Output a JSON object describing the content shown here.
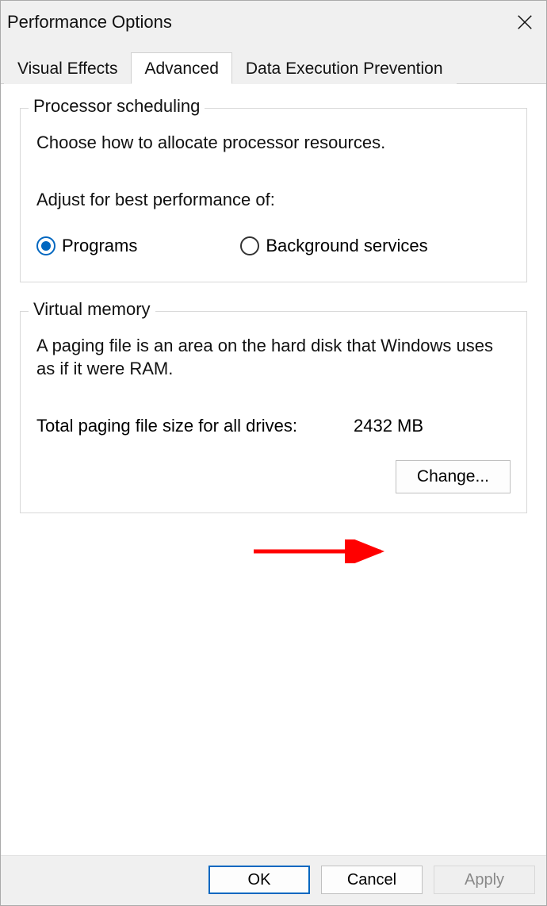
{
  "dialog_title": "Performance Options",
  "tabs": {
    "visual_effects": "Visual Effects",
    "advanced": "Advanced",
    "dep": "Data Execution Prevention"
  },
  "processor_scheduling": {
    "title": "Processor scheduling",
    "description": "Choose how to allocate processor resources.",
    "subtitle": "Adjust for best performance of:",
    "programs_label": "Programs",
    "background_label": "Background services"
  },
  "virtual_memory": {
    "title": "Virtual memory",
    "description": "A paging file is an area on the hard disk that Windows uses as if it were RAM.",
    "total_label": "Total paging file size for all drives:",
    "total_value": "2432 MB",
    "change_label": "Change..."
  },
  "buttons": {
    "ok": "OK",
    "cancel": "Cancel",
    "apply": "Apply"
  }
}
